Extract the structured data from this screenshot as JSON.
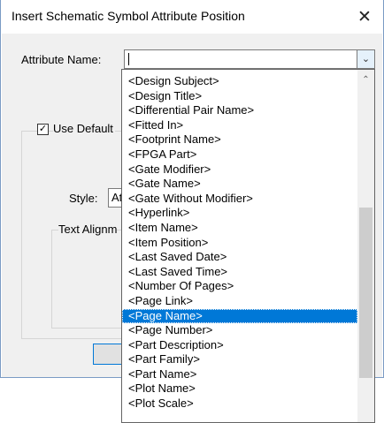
{
  "dialog": {
    "title": "Insert Schematic Symbol Attribute Position",
    "close_glyph": "✕",
    "attribute_name_label": "Attribute Name:",
    "attribute_name_value": "",
    "use_default_label": "Use Default",
    "use_default_checked_glyph": "✓",
    "style_label": "Style:",
    "style_value": "At",
    "text_alignment_label": "Text Alignm",
    "dropdown_glyph": "⌄",
    "scroll_up_glyph": "⌃"
  },
  "dropdown": {
    "items": [
      "<Design Subject>",
      "<Design Title>",
      "<Differential Pair Name>",
      "<Fitted In>",
      "<Footprint Name>",
      "<FPGA Part>",
      "<Gate Modifier>",
      "<Gate Name>",
      "<Gate Without Modifier>",
      "<Hyperlink>",
      "<Item Name>",
      "<Item Position>",
      "<Last Saved Date>",
      "<Last Saved Time>",
      "<Number Of Pages>",
      "<Page Link>",
      "<Page Name>",
      "<Page Number>",
      "<Part Description>",
      "<Part Family>",
      "<Part Name>",
      "<Plot Name>",
      "<Plot Scale>"
    ],
    "selected_index": 16
  },
  "colors": {
    "selection": "#0078d7",
    "border_accent": "#7a9bc4",
    "dialog_background": "#f0f0f0"
  }
}
